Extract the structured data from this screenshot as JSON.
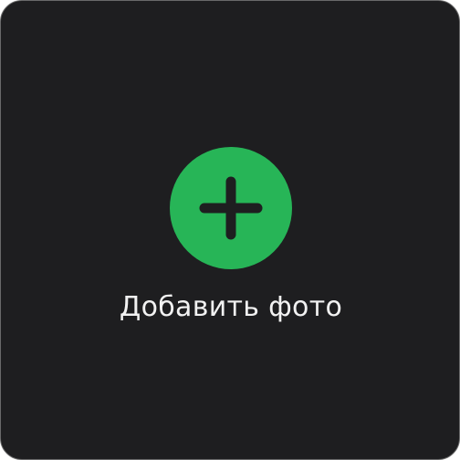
{
  "upload": {
    "label": "Добавить фото",
    "icon": "plus-icon"
  },
  "colors": {
    "background": "#1e1e20",
    "border": "#6a6a6a",
    "accent": "#27b557",
    "icon_stroke": "#1e1e20",
    "label_text": "#f2f2f2"
  }
}
